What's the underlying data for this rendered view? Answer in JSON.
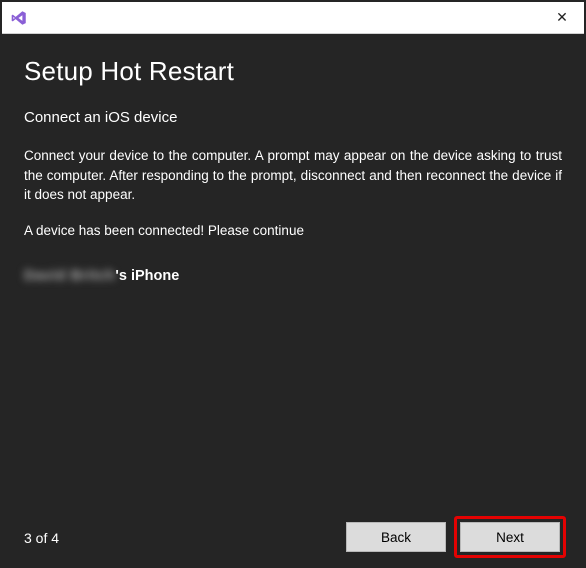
{
  "dialog": {
    "title": "Setup Hot Restart",
    "subtitle": "Connect an iOS device",
    "instructions": "Connect your device to the computer. A prompt may appear on the device asking to trust the computer. After responding to the prompt, disconnect and then reconnect the device if it does not appear.",
    "status": "A device has been connected! Please continue",
    "device": {
      "obscured_name": "David Britch",
      "suffix": "'s iPhone"
    },
    "step_label": "3 of 4",
    "buttons": {
      "back": "Back",
      "next": "Next"
    }
  },
  "titlebar": {
    "close_glyph": "✕"
  }
}
